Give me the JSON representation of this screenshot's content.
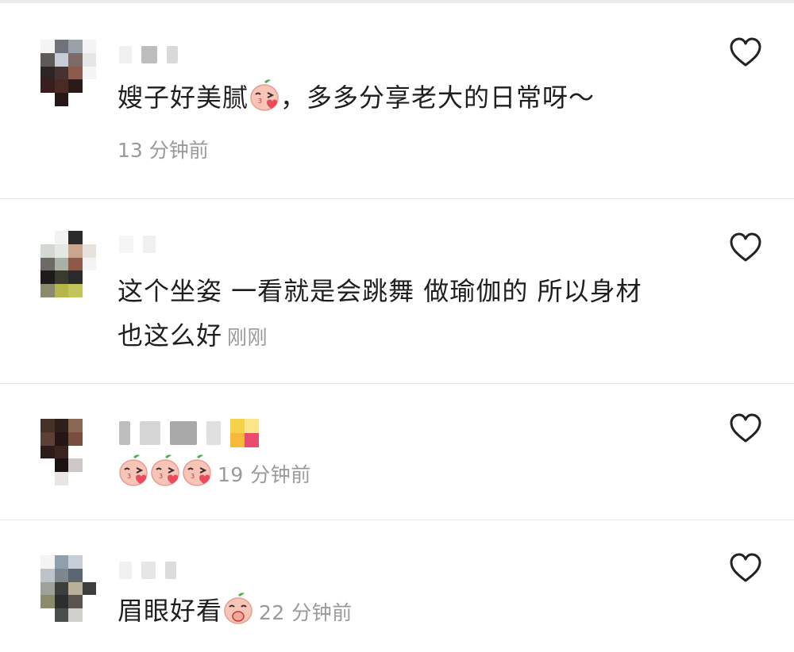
{
  "comments": [
    {
      "text": "嫂子好美腻",
      "text_after_emoji": "，多多分享老大的日常呀～",
      "time": "13 分钟前",
      "emoji": "blushing-peach-emoji"
    },
    {
      "text_line1": "这个坐姿 一看就是会跳舞 做瑜伽的 所以身材",
      "text_line2": "也这么好",
      "time": "刚刚"
    },
    {
      "emoji_count": 3,
      "emoji": "blushing-peach-emoji",
      "time": "19 分钟前"
    },
    {
      "text": "眉眼好看",
      "time": "22 分钟前",
      "emoji": "peach-thinking-emoji"
    }
  ],
  "colors": {
    "text": "#1e1e1e",
    "time": "#9a9a9a",
    "divider": "#e8e8e8",
    "heart_stroke": "#222222",
    "peach_face": "#f7c4b8",
    "peach_heart": "#ec4b5e",
    "leaf": "#4caf50"
  }
}
